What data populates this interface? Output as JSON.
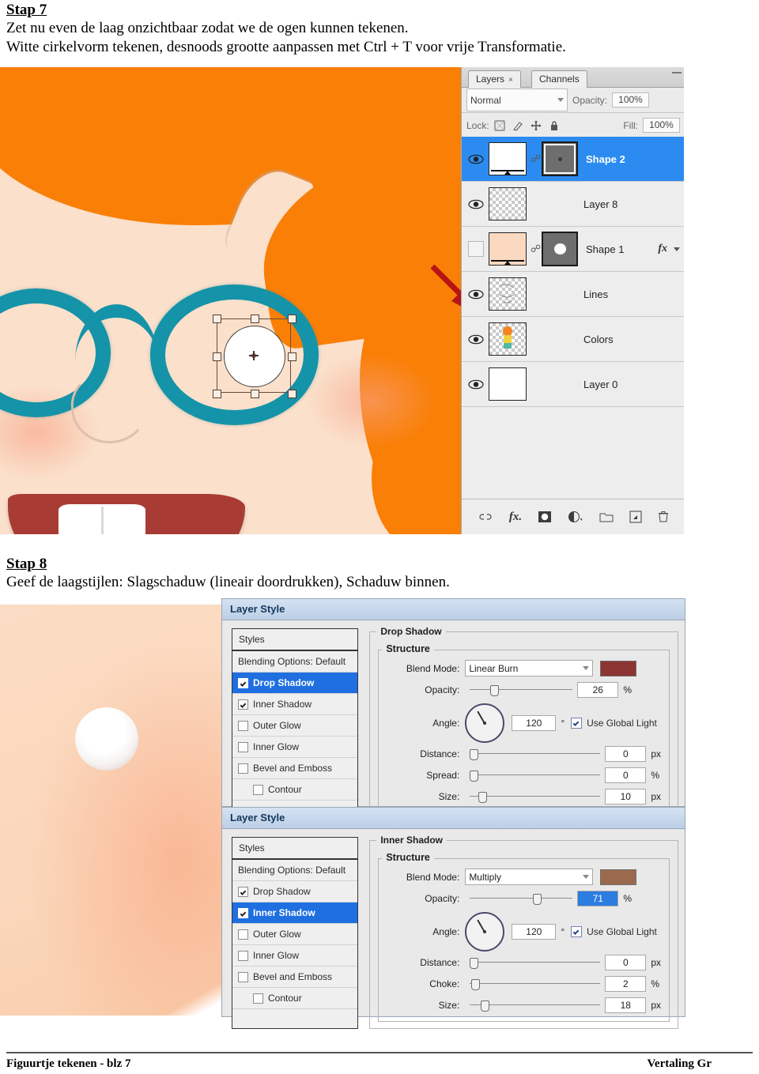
{
  "doc": {
    "step7": {
      "heading": "Stap 7",
      "line1": "Zet nu even de laag onzichtbaar zodat we de ogen kunnen tekenen.",
      "line2": "Witte cirkelvorm tekenen, desnoods grootte aanpassen met Ctrl + T voor vrije Transformatie."
    },
    "step8": {
      "heading": "Stap 8",
      "line1": "Geef de laagstijlen: Slagschaduw (lineair doordrukken), Schaduw binnen."
    },
    "footer": {
      "left": "Figuurtje tekenen - blz 7",
      "right": "Vertaling Gr"
    }
  },
  "layers_panel": {
    "tabs": [
      {
        "label": "Layers",
        "close": "×",
        "selected": true
      },
      {
        "label": "Channels",
        "close": "",
        "selected": false
      }
    ],
    "blend_mode": "Normal",
    "opacity_label": "Opacity:",
    "opacity_value": "100%",
    "lock_label": "Lock:",
    "fill_label": "Fill:",
    "fill_value": "100%",
    "lock_icons": [
      "transparency-lock-icon",
      "brush-lock-icon",
      "move-lock-icon",
      "all-lock-icon"
    ],
    "rows": [
      {
        "name": "Shape 2",
        "visible": true,
        "active": true,
        "kind": "shape",
        "thumb": "white",
        "mask": "dark-dot",
        "fx": false
      },
      {
        "name": "Layer 8",
        "visible": true,
        "active": false,
        "kind": "raster",
        "thumb": "checker",
        "mask": null,
        "fx": false
      },
      {
        "name": "Shape 1",
        "visible": false,
        "active": false,
        "kind": "shape",
        "thumb": "skin",
        "mask": "dark-circle",
        "fx": true,
        "fx_label": "fx"
      },
      {
        "name": "Lines",
        "visible": true,
        "active": false,
        "kind": "raster",
        "thumb": "checker-lines",
        "mask": null,
        "fx": false
      },
      {
        "name": "Colors",
        "visible": true,
        "active": false,
        "kind": "raster",
        "thumb": "checker-figure",
        "mask": null,
        "fx": false
      },
      {
        "name": "Layer 0",
        "visible": true,
        "active": false,
        "kind": "raster",
        "thumb": "white",
        "mask": null,
        "fx": false
      }
    ],
    "footer_icons": [
      "link-layers-icon",
      "add-layer-style-icon",
      "add-layer-mask-icon",
      "new-adjustment-layer-icon",
      "new-group-icon",
      "new-layer-icon",
      "delete-layer-icon"
    ]
  },
  "layer_style_drop_shadow": {
    "title": "Layer Style",
    "styles_header": "Styles",
    "style_items": [
      {
        "label": "Blending Options: Default",
        "checkbox": false,
        "checked": false,
        "selected": false,
        "indent": false
      },
      {
        "label": "Drop Shadow",
        "checkbox": true,
        "checked": true,
        "selected": true,
        "indent": false
      },
      {
        "label": "Inner Shadow",
        "checkbox": true,
        "checked": true,
        "selected": false,
        "indent": false
      },
      {
        "label": "Outer Glow",
        "checkbox": true,
        "checked": false,
        "selected": false,
        "indent": false
      },
      {
        "label": "Inner Glow",
        "checkbox": true,
        "checked": false,
        "selected": false,
        "indent": false
      },
      {
        "label": "Bevel and Emboss",
        "checkbox": true,
        "checked": false,
        "selected": false,
        "indent": false
      },
      {
        "label": "Contour",
        "checkbox": true,
        "checked": false,
        "selected": false,
        "indent": true
      }
    ],
    "group_label": "Drop Shadow",
    "section_label": "Structure",
    "blend_mode_label": "Blend Mode:",
    "blend_mode_value": "Linear Burn",
    "color_swatch": "#8c3432",
    "opacity_label": "Opacity:",
    "opacity_value": "26",
    "opacity_unit": "%",
    "opacity_pct": 26,
    "angle_label": "Angle:",
    "angle_value": "120",
    "angle_unit": "°",
    "use_global_light_label": "Use Global Light",
    "use_global_light": true,
    "distance_label": "Distance:",
    "distance_value": "0",
    "distance_unit": "px",
    "distance_pct": 2,
    "spread_label": "Spread:",
    "spread_value": "0",
    "spread_unit": "%",
    "spread_pct": 2,
    "size_label": "Size:",
    "size_value": "10",
    "size_unit": "px",
    "size_pct": 7
  },
  "layer_style_inner_shadow": {
    "title": "Layer Style",
    "styles_header": "Styles",
    "style_items": [
      {
        "label": "Blending Options: Default",
        "checkbox": false,
        "checked": false,
        "selected": false,
        "indent": false
      },
      {
        "label": "Drop Shadow",
        "checkbox": true,
        "checked": true,
        "selected": false,
        "indent": false
      },
      {
        "label": "Inner Shadow",
        "checkbox": true,
        "checked": true,
        "selected": true,
        "indent": false
      },
      {
        "label": "Outer Glow",
        "checkbox": true,
        "checked": false,
        "selected": false,
        "indent": false
      },
      {
        "label": "Inner Glow",
        "checkbox": true,
        "checked": false,
        "selected": false,
        "indent": false
      },
      {
        "label": "Bevel and Emboss",
        "checkbox": true,
        "checked": false,
        "selected": false,
        "indent": false
      },
      {
        "label": "Contour",
        "checkbox": true,
        "checked": false,
        "selected": false,
        "indent": true
      }
    ],
    "group_label": "Inner Shadow",
    "section_label": "Structure",
    "blend_mode_label": "Blend Mode:",
    "blend_mode_value": "Multiply",
    "color_swatch": "#9b6a4e",
    "opacity_label": "Opacity:",
    "opacity_value": "71",
    "opacity_unit": "%",
    "opacity_pct": 71,
    "angle_label": "Angle:",
    "angle_value": "120",
    "angle_unit": "°",
    "use_global_light_label": "Use Global Light",
    "use_global_light": true,
    "distance_label": "Distance:",
    "distance_value": "0",
    "distance_unit": "px",
    "distance_pct": 2,
    "choke_label": "Choke:",
    "choke_value": "2",
    "choke_unit": "%",
    "choke_pct": 3,
    "size_label": "Size:",
    "size_value": "18",
    "size_unit": "px",
    "size_pct": 10
  },
  "artwork": {
    "top": {
      "description": "cartoon-face-closeup-with-transform-box",
      "hair_color": "#f97f06",
      "skin_color": "#fbe0cb",
      "glasses_color": "#1593a8",
      "mouth_color": "#a83c34",
      "arrow_color": "#b81414"
    },
    "bottom": {
      "description": "skin-closeup-with-white-eye-highlight",
      "skin_color": "#fbdcc4",
      "highlight_color": "#ffffff"
    }
  }
}
